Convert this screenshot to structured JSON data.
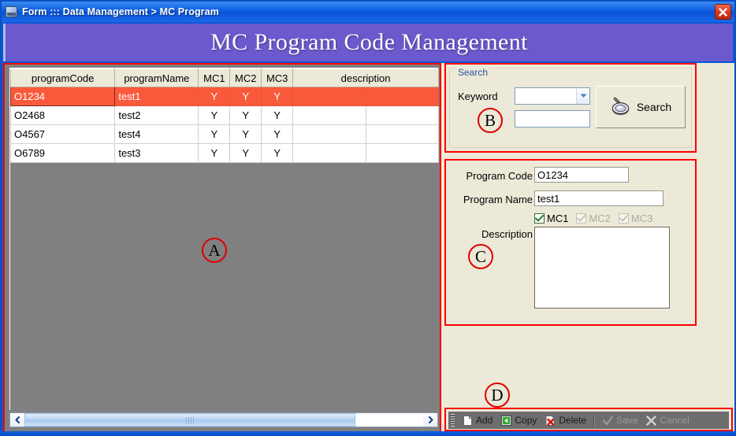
{
  "window": {
    "title": "Form ::: Data Management > MC Program",
    "close_label": "×",
    "banner_title": "MC Program Code Management",
    "accent_title_bar": "#0a5ae0",
    "accent_banner": "#6a5acd",
    "annotation_color": "#ff0000"
  },
  "grid": {
    "columns": [
      "programCode",
      "programName",
      "MC1",
      "MC2",
      "MC3",
      "description"
    ],
    "rows": [
      {
        "programCode": "O1234",
        "programName": "test1",
        "mc1": "Y",
        "mc2": "Y",
        "mc3": "Y",
        "description": "",
        "selected": true
      },
      {
        "programCode": "O2468",
        "programName": "test2",
        "mc1": "Y",
        "mc2": "Y",
        "mc3": "Y",
        "description": "",
        "selected": false
      },
      {
        "programCode": "O4567",
        "programName": "test4",
        "mc1": "Y",
        "mc2": "Y",
        "mc3": "Y",
        "description": "",
        "selected": false
      },
      {
        "programCode": "O6789",
        "programName": "test3",
        "mc1": "Y",
        "mc2": "Y",
        "mc3": "Y",
        "description": "",
        "selected": false
      }
    ],
    "selected_row_color": "#fa5a3c",
    "scrollbar": {
      "left_arrow": "◄",
      "right_arrow": "►",
      "thumb_percent": 83
    }
  },
  "search": {
    "legend": "Search",
    "keyword_label": "Keyword",
    "combo_value": "",
    "combo_placeholder": "",
    "input_value": "",
    "input_placeholder": "",
    "button_label": "Search"
  },
  "detail": {
    "program_code_label": "Program Code",
    "program_code_value": "O1234",
    "program_name_label": "Program Name",
    "program_name_value": "test1",
    "description_label": "Description",
    "description_value": "",
    "checkboxes": [
      {
        "label": "MC1",
        "checked": true,
        "enabled": true
      },
      {
        "label": "MC2",
        "checked": true,
        "enabled": false
      },
      {
        "label": "MC3",
        "checked": true,
        "enabled": false
      }
    ]
  },
  "toolbar": {
    "buttons": [
      {
        "label": "Add",
        "icon": "new-page-icon",
        "enabled": true
      },
      {
        "label": "Copy",
        "icon": "copy-icon",
        "enabled": true
      },
      {
        "label": "Delete",
        "icon": "delete-icon",
        "enabled": true
      },
      {
        "label": "Save",
        "icon": "check-icon",
        "enabled": false
      },
      {
        "label": "Cancel",
        "icon": "x-icon",
        "enabled": false
      }
    ]
  },
  "annotations": {
    "a": "A",
    "b": "B",
    "c": "C",
    "d": "D"
  }
}
